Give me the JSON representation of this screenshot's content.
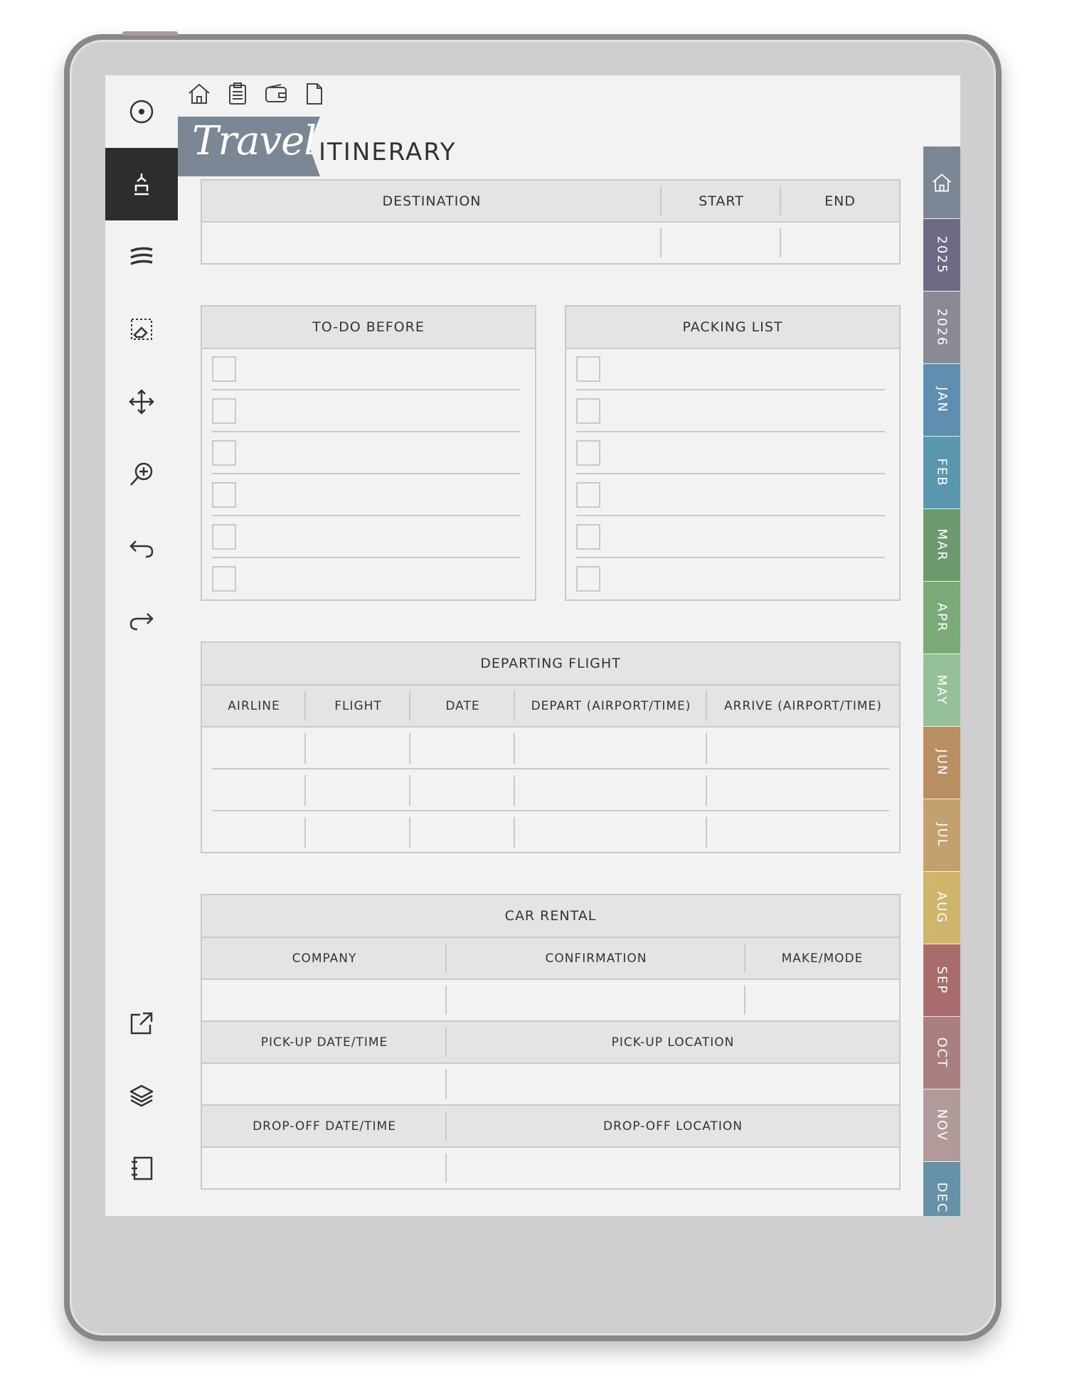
{
  "header": {
    "title_script": "Travel",
    "title_rest": "ITINERARY"
  },
  "top_icons": [
    "home-icon",
    "clipboard-icon",
    "wallet-icon",
    "page-icon"
  ],
  "toolbar": {
    "tools": [
      "circle-menu-icon",
      "pen-icon",
      "lines-icon",
      "eraser-icon",
      "move-icon",
      "zoom-icon",
      "undo-icon",
      "redo-icon"
    ],
    "bottom_tools": [
      "export-icon",
      "layers-icon",
      "notebook-icon"
    ]
  },
  "trip": {
    "headers": [
      "DESTINATION",
      "START",
      "END"
    ]
  },
  "todo": {
    "title": "TO-DO BEFORE",
    "rows": 6
  },
  "packing": {
    "title": "PACKING LIST",
    "rows": 6
  },
  "flight": {
    "title": "DEPARTING FLIGHT",
    "columns": [
      "AIRLINE",
      "FLIGHT",
      "DATE",
      "DEPART (AIRPORT/TIME)",
      "ARRIVE (AIRPORT/TIME)"
    ],
    "rows": 3
  },
  "car": {
    "title": "CAR RENTAL",
    "columns": [
      "COMPANY",
      "CONFIRMATION",
      "MAKE/MODE"
    ],
    "pickup_date": "PICK-UP DATE/TIME",
    "pickup_location": "PICK-UP LOCATION",
    "dropoff_date": "DROP-OFF DATE/TIME",
    "dropoff_location": "DROP-OFF LOCATION"
  },
  "tabs": [
    {
      "label": "",
      "icon": "home-icon",
      "color": "#7c8796"
    },
    {
      "label": "2025",
      "color": "#6f6a84"
    },
    {
      "label": "2026",
      "color": "#8a8a94"
    },
    {
      "label": "JAN",
      "color": "#5f8fb0"
    },
    {
      "label": "FEB",
      "color": "#5a97ae"
    },
    {
      "label": "MAR",
      "color": "#6a9a6e"
    },
    {
      "label": "APR",
      "color": "#7aaa78"
    },
    {
      "label": "MAY",
      "color": "#96c09a"
    },
    {
      "label": "JUN",
      "color": "#b88e62"
    },
    {
      "label": "JUL",
      "color": "#c3a06e"
    },
    {
      "label": "AUG",
      "color": "#cfb46c"
    },
    {
      "label": "SEP",
      "color": "#a86c6c"
    },
    {
      "label": "OCT",
      "color": "#a97f7f"
    },
    {
      "label": "NOV",
      "color": "#b09a9a"
    },
    {
      "label": "DEC",
      "color": "#6790a9"
    }
  ],
  "colors": {
    "banner": "#7c8796",
    "border": "#c9c9c9",
    "header_fill": "#e4e4e4",
    "paper": "#f2f2f2"
  }
}
